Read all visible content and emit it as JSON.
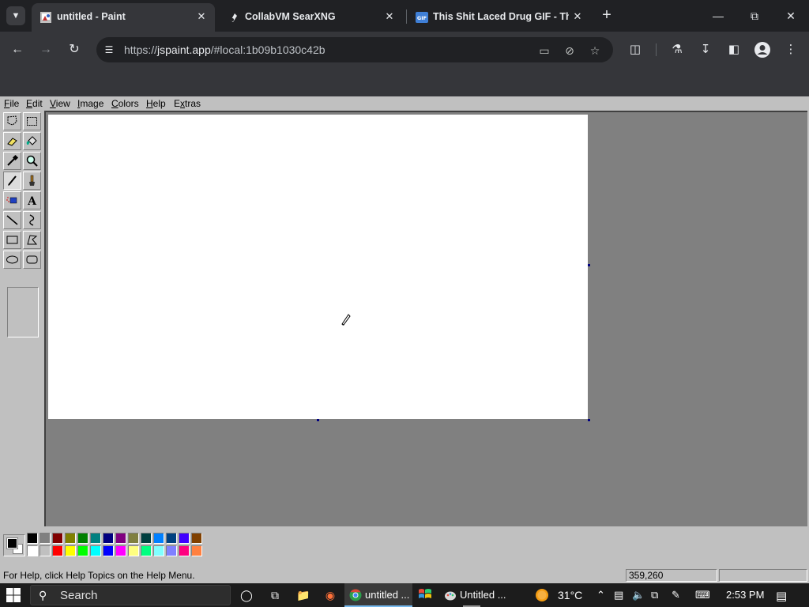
{
  "browser": {
    "tabs": [
      {
        "title": "untitled - Paint",
        "active": true,
        "favicon": "paint-favicon"
      },
      {
        "title": "CollabVM SearXNG",
        "active": false,
        "favicon": "searx-favicon"
      },
      {
        "title": "This Shit Laced Drug GIF - This",
        "active": false,
        "favicon": "gif-favicon"
      }
    ],
    "url_scheme": "https://",
    "url_host": "jspaint.app",
    "url_rest": "/#local:1b09b1030c42b",
    "icons": {
      "back": "arrow-left-icon",
      "forward": "arrow-right-icon",
      "reload": "reload-icon",
      "site_info": "tune-icon",
      "install": "install-app-icon",
      "tracking": "eye-off-icon",
      "bookmark": "star-icon",
      "extensions": "puzzle-icon",
      "labs": "flask-icon",
      "downloads": "download-icon",
      "side_panel": "side-panel-icon",
      "profile": "profile-icon",
      "menu": "kebab-menu-icon"
    }
  },
  "paint": {
    "menus": [
      {
        "label": "File",
        "key": "F"
      },
      {
        "label": "Edit",
        "key": "E"
      },
      {
        "label": "View",
        "key": "V"
      },
      {
        "label": "Image",
        "key": "I"
      },
      {
        "label": "Colors",
        "key": "C"
      },
      {
        "label": "Help",
        "key": "H"
      },
      {
        "label": "Extras",
        "key": "x"
      }
    ],
    "tools": [
      "free-form-select",
      "select",
      "eraser",
      "fill-with-color",
      "pick-color",
      "magnifier",
      "pencil",
      "brush",
      "airbrush",
      "text",
      "line",
      "curve",
      "rectangle",
      "polygon",
      "ellipse",
      "rounded-rectangle"
    ],
    "selected_tool": "pencil",
    "palette_top": [
      "#000000",
      "#808080",
      "#800000",
      "#808000",
      "#008000",
      "#008080",
      "#000080",
      "#800080",
      "#808040",
      "#004040",
      "#0080ff",
      "#004080",
      "#4000ff",
      "#804000"
    ],
    "palette_bottom": [
      "#ffffff",
      "#c0c0c0",
      "#ff0000",
      "#ffff00",
      "#00ff00",
      "#00ffff",
      "#0000ff",
      "#ff00ff",
      "#ffff80",
      "#00ff80",
      "#80ffff",
      "#8080ff",
      "#ff0080",
      "#ff8040"
    ],
    "foreground": "#000000",
    "background": "#ffffff",
    "status_help": "For Help, click Help Topics on the Help Menu.",
    "status_coords": "359,260",
    "status_size": ""
  },
  "taskbar": {
    "search_label": "Search",
    "apps": [
      {
        "label": "untitled ...",
        "icon": "chrome-icon",
        "active": true
      },
      {
        "label": "Untitled ...",
        "icon": "paint-icon",
        "active": false
      }
    ],
    "weather_temp": "31°C",
    "time": "2:53 PM"
  }
}
